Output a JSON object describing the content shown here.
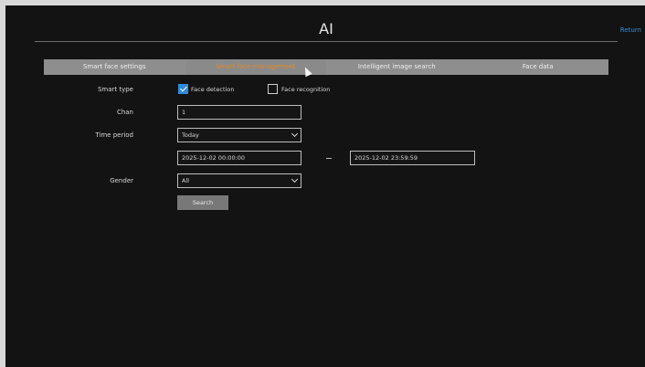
{
  "window": {
    "title": "AI",
    "return_label": "Return"
  },
  "tabs": [
    {
      "label": "Smart face settings",
      "active": false
    },
    {
      "label": "Smart face management",
      "active": true
    },
    {
      "label": "Intelligent image search",
      "active": false
    },
    {
      "label": "Face data",
      "active": false
    }
  ],
  "form": {
    "smart_type": {
      "label": "Smart type",
      "options": [
        {
          "label": "Face detection",
          "checked": true
        },
        {
          "label": "Face recognition",
          "checked": false
        }
      ]
    },
    "chan": {
      "label": "Chan",
      "value": "1"
    },
    "time_period": {
      "label": "Time period",
      "selected": "Today",
      "start": "2025-12-02 00:00:00",
      "end": "2025-12-02 23:59:59"
    },
    "gender": {
      "label": "Gender",
      "selected": "All"
    },
    "search_label": "Search"
  },
  "colors": {
    "background": "#131313",
    "tab_bar": "#8e8e8e",
    "active_tab_text": "#e38a2a",
    "checkbox_checked": "#2f8ad8",
    "return_link": "#3a8fd6"
  }
}
